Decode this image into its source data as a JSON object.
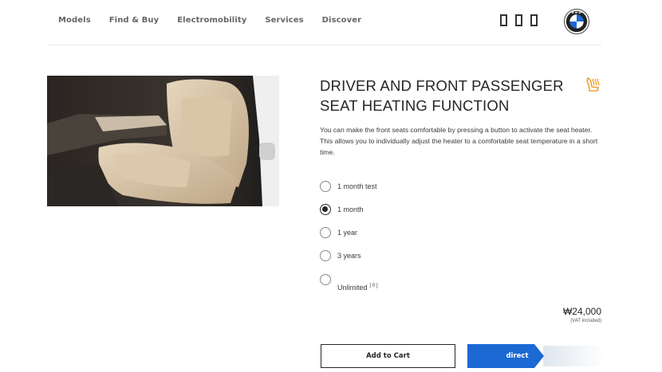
{
  "nav": {
    "items": [
      "Models",
      "Find & Buy",
      "Electromobility",
      "Services",
      "Discover"
    ]
  },
  "header": {
    "icons": [
      "header-icon-1",
      "header-icon-2",
      "header-icon-3"
    ],
    "logo": "bmw-logo"
  },
  "product": {
    "title_line1": "DRIVER AND FRONT PASSENGER",
    "title_line2": "SEAT HEATING FUNCTION",
    "description": "You can make the front seats comfortable by pressing a button to activate the seat heater. This allows you to individually adjust the heater to a comfortable seat temperature in a short time.",
    "icon": "seat-heating-icon",
    "icon_color": "#f0a030"
  },
  "options": [
    {
      "label": "1 month test",
      "selected": false
    },
    {
      "label": "1 month",
      "selected": true
    },
    {
      "label": "1 year",
      "selected": false
    },
    {
      "label": "3 years",
      "selected": false
    },
    {
      "label": "Unlimited",
      "sup": "[ 0 ]",
      "selected": false
    }
  ],
  "price": {
    "amount": "₩24,000",
    "vat_note": "(VAT included)"
  },
  "actions": {
    "add_to_cart": "Add to Cart",
    "direct": "direct",
    "direct_color": "#1c69d4"
  }
}
